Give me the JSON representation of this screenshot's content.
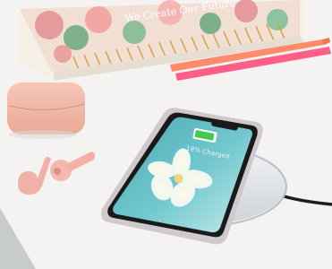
{
  "photo": {
    "subject": "smartphone charging on a wireless charging pad",
    "colors": {
      "background": "#f4f3f1",
      "earbuds_case": "#f0b7a6",
      "earbuds": "#f2b1a8",
      "pens": "#ff6a88",
      "charger_pad": "#e3e6ea",
      "cable": "#1c1c1c",
      "phone_frame": "#c9c1c6",
      "screen_start": "#58b3b8",
      "screen_end": "#b7e6e6",
      "battery_fill": "#49c84f"
    },
    "phone_screen": {
      "charging_text": "18% Charged",
      "battery_level": 0.18,
      "battery_icon": "battery-icon"
    },
    "notebook": {
      "cover_lettering": "We Create Our Future",
      "pattern": "floral"
    },
    "floor_mat": {
      "color": "#c8cbcc"
    }
  }
}
